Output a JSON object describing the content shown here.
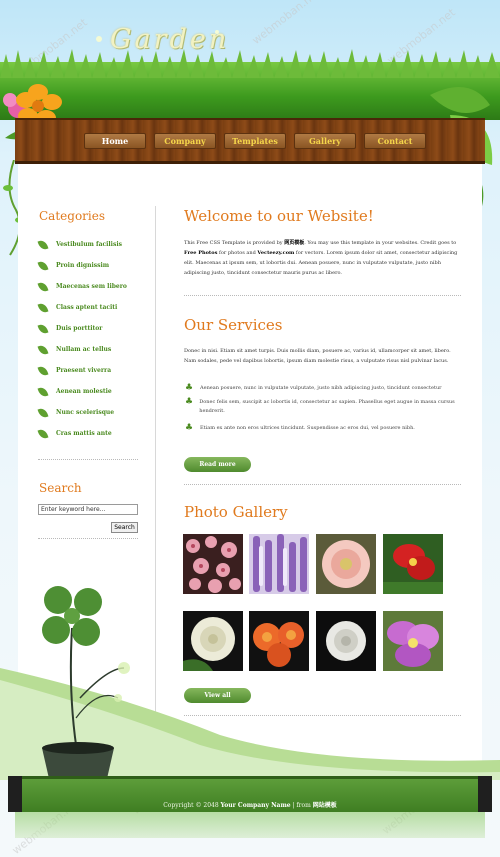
{
  "site": {
    "logo": "Garden"
  },
  "nav": {
    "items": [
      {
        "label": "Home"
      },
      {
        "label": "Company"
      },
      {
        "label": "Templates"
      },
      {
        "label": "Gallery"
      },
      {
        "label": "Contact"
      }
    ]
  },
  "sidebar": {
    "categories_title": "Categories",
    "categories": [
      {
        "label": "Vestibulum facilisis"
      },
      {
        "label": "Proin dignissim"
      },
      {
        "label": "Maecenas sem libero"
      },
      {
        "label": "Class aptent taciti"
      },
      {
        "label": "Duis porttitor"
      },
      {
        "label": "Nullam ac tellus"
      },
      {
        "label": "Praesent viverra"
      },
      {
        "label": "Aenean molestie"
      },
      {
        "label": "Nunc scelerisque"
      },
      {
        "label": "Cras mattis ante"
      }
    ],
    "search_title": "Search",
    "search_value": "Enter keyword here...",
    "search_button": "Search"
  },
  "main": {
    "welcome": {
      "title": "Welcome to our Website!",
      "p1": "This Free CSS Template is provided by ",
      "b1": "网页模板",
      "p2": ". You may use this template in your websites. Credit goes to ",
      "b2": "Free Photos",
      "p3": " for photos and ",
      "b3": "Vecteezy.com",
      "p4": " for vectors. Lorem ipsum dolor sit amet, consectetur adipiscing elit. Maecenas at ipsum sem, ut lobortis dui. Aenean posuere, nunc in vulputate vulputate, justo nibh adipiscing justo, tincidunt consectetur mauris purus ac libero."
    },
    "services": {
      "title": "Our Services",
      "intro": "Donec in nisi. Etiam sit amet turpis. Duis mollis diam, posuere ac, varius id, ullamcorper sit amet, libero. Nam sodales, pede vel dapibus lobortis, ipsum diam molestie risus, a vulputate risus nisl pulvinar lacus.",
      "items": [
        {
          "text": "Aenean posuere, nunc in vulputate vulputate, justo nibh adipiscing justo, tincidunt consectetur"
        },
        {
          "text": "Donec felis sem, suscipit ac lobortis id, consectetur ac sapien. Phasellus eget augue in massa cursus hendrerit."
        },
        {
          "text": "Etiam ex ante non eros ultrices tincidunt. Suspendisse ac eros dui, vel posuere nibh."
        }
      ],
      "button": "Read more"
    },
    "gallery": {
      "title": "Photo Gallery",
      "button": "View all"
    }
  },
  "footer": {
    "prefix": "Copyright © 2048 ",
    "company": "Your Company Name",
    "middle": " | from ",
    "source": "网站模板"
  },
  "watermark": "webmoban.net",
  "colors": {
    "heading": "#e07a1e",
    "category_link": "#4a8a1f",
    "button_green": "#5f9a3a"
  }
}
